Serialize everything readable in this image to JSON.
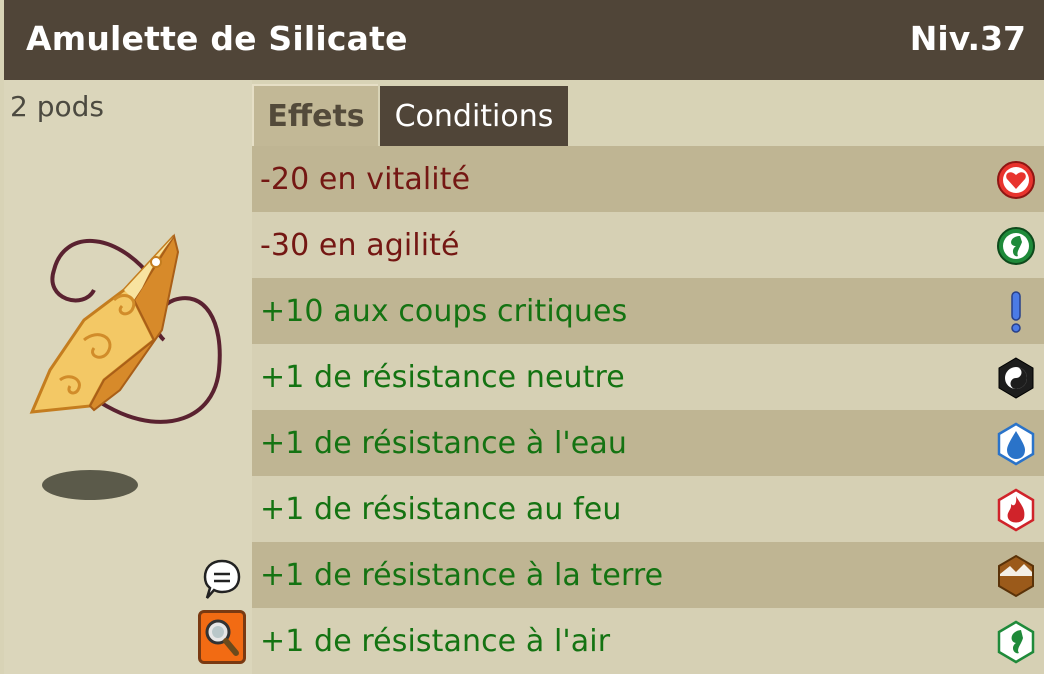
{
  "item": {
    "name": "Amulette de Silicate",
    "level": "Niv.37",
    "weight": "2 pods"
  },
  "tabs": [
    {
      "label": "Effets",
      "active": true
    },
    {
      "label": "Conditions",
      "active": false
    }
  ],
  "colors": {
    "header_bg": "#504538",
    "negative_text": "#741713",
    "positive_text": "#147312"
  },
  "effects": [
    {
      "text": "-20 en vitalité",
      "kind": "negative",
      "icon": "vitality-heart-icon"
    },
    {
      "text": "-30 en agilité",
      "kind": "negative",
      "icon": "agility-icon"
    },
    {
      "text": "+10 aux coups critiques",
      "kind": "positive",
      "icon": "critical-exclamation-icon"
    },
    {
      "text": "+1 de résistance neutre",
      "kind": "positive",
      "icon": "neutral-element-icon"
    },
    {
      "text": "+1 de résistance à l'eau",
      "kind": "positive",
      "icon": "water-element-icon"
    },
    {
      "text": "+1 de résistance au feu",
      "kind": "positive",
      "icon": "fire-element-icon"
    },
    {
      "text": "+1 de résistance à la terre",
      "kind": "positive",
      "icon": "earth-element-icon"
    },
    {
      "text": "+1 de résistance à l'air",
      "kind": "positive",
      "icon": "air-element-icon"
    }
  ]
}
